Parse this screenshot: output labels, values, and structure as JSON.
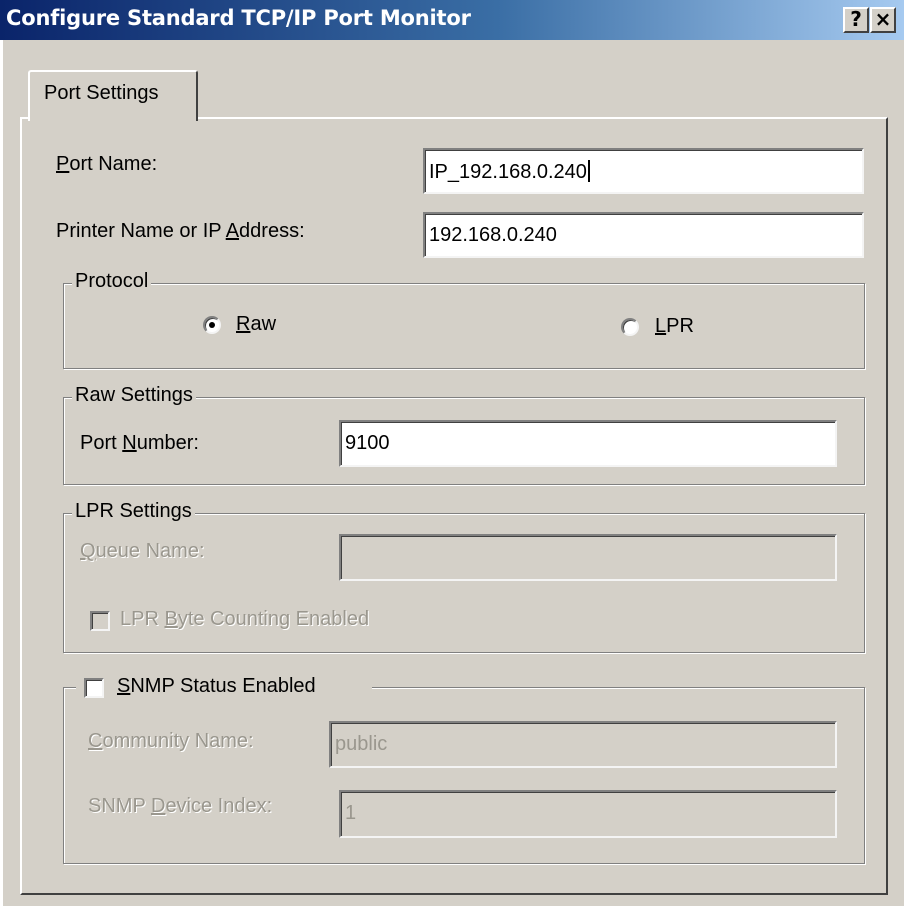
{
  "window": {
    "title": "Configure Standard TCP/IP Port Monitor",
    "help_button": "?",
    "close_button": "×"
  },
  "tabs": [
    {
      "label": "Port Settings",
      "selected": true
    }
  ],
  "port_name": {
    "label": "ort Name:",
    "mnemonic": "P",
    "value": "IP_192.168.0.240"
  },
  "printer_address": {
    "label_pre": "Printer Name or IP ",
    "mnemonic": "A",
    "label_post": "ddress:",
    "value": "192.168.0.240"
  },
  "protocol": {
    "title": "Protocol",
    "options": [
      {
        "mnemonic": "R",
        "rest": "aw",
        "selected": true
      },
      {
        "mnemonic": "L",
        "rest": "PR",
        "selected": false
      }
    ]
  },
  "raw_settings": {
    "title": "Raw Settings",
    "port_number": {
      "label_pre": "Port ",
      "mnemonic": "N",
      "label_post": "umber:",
      "value": "9100"
    }
  },
  "lpr_settings": {
    "title": "LPR Settings",
    "queue_name": {
      "mnemonic": "Q",
      "label_post": "ueue Name:",
      "value": ""
    },
    "byte_counting": {
      "label_pre": "LPR ",
      "mnemonic": "B",
      "label_post": "yte Counting Enabled",
      "checked": false
    }
  },
  "snmp": {
    "status_enabled": {
      "mnemonic": "S",
      "label_post": "NMP Status Enabled",
      "checked": false
    },
    "community_name": {
      "mnemonic": "C",
      "label_post": "ommunity Name:",
      "value": "public"
    },
    "device_index": {
      "label_pre": "SNMP ",
      "mnemonic": "D",
      "label_post": "evice Index:",
      "value": "1"
    }
  }
}
